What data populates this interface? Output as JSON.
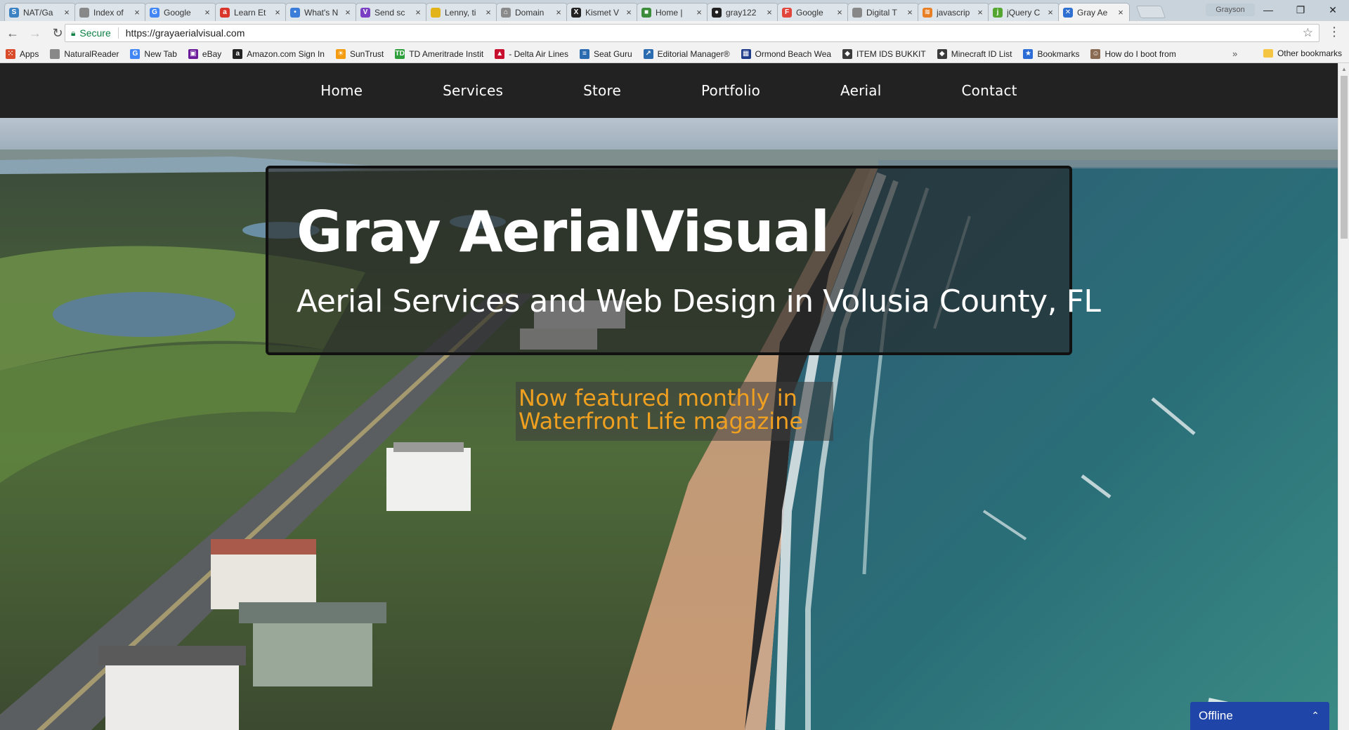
{
  "browser": {
    "tabs": [
      {
        "title": "NAT/Ga",
        "icon": "tab-favicon-nat",
        "color": "#3a82c4",
        "glyph": "S"
      },
      {
        "title": "Index of",
        "icon": "document-icon",
        "color": "#888888",
        "glyph": ""
      },
      {
        "title": "Google",
        "icon": "google-icon",
        "color": "#4285f4",
        "glyph": "G"
      },
      {
        "title": "Learn Et",
        "icon": "tab-favicon-learn",
        "color": "#d9352b",
        "glyph": "a"
      },
      {
        "title": "What's N",
        "icon": "tab-favicon-whats",
        "color": "#3b7dd8",
        "glyph": "•"
      },
      {
        "title": "Send sc",
        "icon": "tab-favicon-send",
        "color": "#7b3fc4",
        "glyph": "V"
      },
      {
        "title": "Lenny, ti",
        "icon": "tab-favicon-lenny",
        "color": "#e3b31a",
        "glyph": ""
      },
      {
        "title": "Domain",
        "icon": "tab-favicon-domain",
        "color": "#8a8a8a",
        "glyph": "⌂"
      },
      {
        "title": "Kismet V",
        "icon": "tab-favicon-kismet",
        "color": "#222222",
        "glyph": "X"
      },
      {
        "title": "Home |",
        "icon": "tab-favicon-home",
        "color": "#3c8c3c",
        "glyph": "■"
      },
      {
        "title": "gray122",
        "icon": "github-icon",
        "color": "#222222",
        "glyph": "●"
      },
      {
        "title": "Google",
        "icon": "tab-favicon-google-f",
        "color": "#e2453c",
        "glyph": "F"
      },
      {
        "title": "Digital T",
        "icon": "document-icon",
        "color": "#888888",
        "glyph": ""
      },
      {
        "title": "javascrip",
        "icon": "tab-favicon-js",
        "color": "#e87f25",
        "glyph": "≋"
      },
      {
        "title": "jQuery C",
        "icon": "tab-favicon-jquery",
        "color": "#55a630",
        "glyph": "j"
      },
      {
        "title": "Gray Ae",
        "icon": "tab-favicon-gray",
        "color": "#2e6fd1",
        "glyph": "✕",
        "active": true
      }
    ],
    "profile": "Grayson",
    "address": {
      "secure_label": "Secure",
      "url": "https://grayaerialvisual.com"
    },
    "bookmarks": [
      {
        "label": "Apps",
        "icon": "apps-icon",
        "color": "#d94b2b",
        "glyph": "⁙"
      },
      {
        "label": "NaturalReader",
        "icon": "document-icon",
        "color": "#888888",
        "glyph": ""
      },
      {
        "label": "New Tab",
        "icon": "google-icon",
        "color": "#4285f4",
        "glyph": "G"
      },
      {
        "label": "eBay",
        "icon": "ebay-icon",
        "color": "#6a1b9a",
        "glyph": "▣"
      },
      {
        "label": "Amazon.com Sign In",
        "icon": "amazon-icon",
        "color": "#222222",
        "glyph": "a"
      },
      {
        "label": "SunTrust",
        "icon": "suntrust-icon",
        "color": "#f39c12",
        "glyph": "☀"
      },
      {
        "label": "TD Ameritrade Instit",
        "icon": "td-icon",
        "color": "#2e9e3a",
        "glyph": "TD"
      },
      {
        "label": "- Delta Air Lines",
        "icon": "delta-icon",
        "color": "#c8102e",
        "glyph": "▲"
      },
      {
        "label": "Seat Guru",
        "icon": "seatguru-icon",
        "color": "#2b6cb0",
        "glyph": "≡"
      },
      {
        "label": "Editorial Manager®",
        "icon": "editorial-icon",
        "color": "#2b6cb0",
        "glyph": "↗"
      },
      {
        "label": "Ormond Beach Wea",
        "icon": "weather-icon",
        "color": "#1e3a8a",
        "glyph": "▦"
      },
      {
        "label": "ITEM IDS BUKKIT",
        "icon": "minecraft-icon",
        "color": "#3b3b3b",
        "glyph": "◆"
      },
      {
        "label": "Minecraft ID List",
        "icon": "minecraft-icon",
        "color": "#3b3b3b",
        "glyph": "◆"
      },
      {
        "label": "Bookmarks",
        "icon": "star-icon",
        "color": "#2b6cd6",
        "glyph": "★"
      },
      {
        "label": "How do I boot from",
        "icon": "avatar-icon",
        "color": "#8a6a50",
        "glyph": "☺"
      }
    ],
    "more_bookmarks": "»",
    "other_bookmarks": "Other bookmarks"
  },
  "site": {
    "nav": [
      "Home",
      "Services",
      "Store",
      "Portfolio",
      "Aerial",
      "Contact"
    ],
    "hero": {
      "title": "Gray AerialVisual",
      "subtitle": "Aerial Services and Web Design in Volusia County, FL",
      "feature_line1": "Now featured monthly in",
      "feature_line2": "Waterfront Life magazine"
    },
    "chat": {
      "status": "Offline",
      "caret": "⌃"
    }
  }
}
